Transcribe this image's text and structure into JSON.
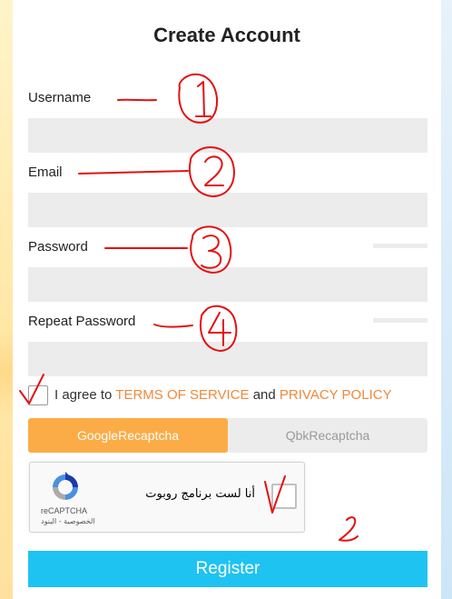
{
  "form": {
    "title": "Create Account",
    "fields": [
      {
        "label": "Username",
        "value": "",
        "placeholder": ""
      },
      {
        "label": "Email",
        "value": "",
        "placeholder": ""
      },
      {
        "label": "Password",
        "value": "",
        "placeholder": ""
      },
      {
        "label": "Repeat Password",
        "value": "",
        "placeholder": ""
      }
    ],
    "agree": {
      "prefix": "I agree to",
      "terms": "TERMS OF SERVICE",
      "and": "and",
      "privacy": "PRIVACY POLICY"
    },
    "captcha_tabs": [
      "GoogleRecaptcha",
      "QbkRecaptcha"
    ],
    "captcha_active_tab": "GoogleRecaptcha",
    "recaptcha": {
      "label": "أنا لست برنامج روبوت",
      "brand": "reCAPTCHA",
      "links": "الخصوصية - البنود"
    },
    "register_label": "Register"
  },
  "annotations": [
    "1",
    "2",
    "3",
    "4"
  ],
  "colors": {
    "accent_orange": "#fbac46",
    "link_orange": "#f0883a",
    "register_blue": "#1fc3f1",
    "input_gray": "#ececec",
    "annotation_red": "#e31212"
  }
}
